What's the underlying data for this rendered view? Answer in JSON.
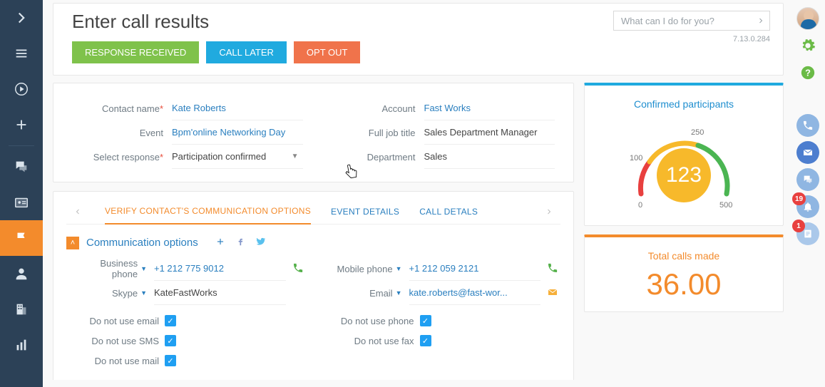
{
  "header": {
    "title": "Enter call results",
    "version": "7.13.0.284",
    "search_placeholder": "What can I do for you?",
    "buttons": {
      "response_received": "RESPONSE RECEIVED",
      "call_later": "CALL LATER",
      "opt_out": "OPT OUT"
    }
  },
  "form": {
    "labels": {
      "contact_name": "Contact name",
      "event": "Event",
      "select_response": "Select response",
      "account": "Account",
      "full_job_title": "Full job title",
      "department": "Department"
    },
    "values": {
      "contact_name": "Kate Roberts",
      "event": "Bpm'online Networking Day",
      "select_response": "Participation confirmed",
      "account": "Fast Works",
      "full_job_title": "Sales Department Manager",
      "department": "Sales"
    }
  },
  "tabs": {
    "verify": "VERIFY CONTACT'S COMMUNICATION OPTIONS",
    "event_details": "EVENT DETAILS",
    "call_details": "CALL DETALS"
  },
  "comm": {
    "section_title": "Communication options",
    "labels": {
      "business_phone": "Business phone",
      "skype": "Skype",
      "mobile_phone": "Mobile phone",
      "email": "Email"
    },
    "values": {
      "business_phone": "+1 212 775 9012",
      "skype": "KateFastWorks",
      "mobile_phone": "+1 212 059 2121",
      "email": "kate.roberts@fast-wor..."
    },
    "dnu": {
      "email": "Do not use email",
      "sms": "Do not use SMS",
      "mail": "Do not use mail",
      "phone": "Do not use phone",
      "fax": "Do not use fax"
    }
  },
  "dash": {
    "confirmed_title": "Confirmed participants",
    "total_calls_title": "Total calls made",
    "total_calls_value": "36.00"
  },
  "chart_data": {
    "type": "gauge",
    "title": "Confirmed participants",
    "value": 123,
    "min": 0,
    "max": 500,
    "ticks": [
      0,
      100,
      250,
      500
    ],
    "zones": [
      {
        "from": 0,
        "to": 100,
        "color": "#e8403f"
      },
      {
        "from": 100,
        "to": 250,
        "color": "#f7b92b"
      },
      {
        "from": 250,
        "to": 500,
        "color": "#4bb552"
      }
    ]
  },
  "badges": {
    "bell": "19",
    "feed": "1"
  },
  "gauge_labels": {
    "t100": "100",
    "t250": "250",
    "t0": "0",
    "t500": "500",
    "center": "123"
  }
}
